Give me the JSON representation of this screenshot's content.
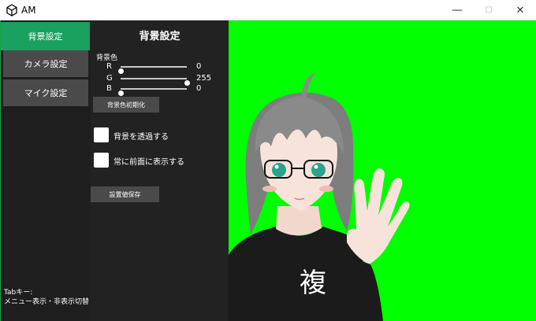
{
  "window": {
    "title": "AM",
    "minimize_glyph": "—",
    "maximize_glyph": "☐",
    "close_glyph": "✕"
  },
  "sidebar": {
    "tabs": [
      {
        "label": "背景設定",
        "active": true
      },
      {
        "label": "カメラ設定",
        "active": false
      },
      {
        "label": "マイク設定",
        "active": false
      }
    ],
    "help_line1": "Tabキー:",
    "help_line2": "メニュー表示・非表示切替"
  },
  "panel": {
    "title": "背景設定",
    "color_label": "背景色",
    "channels": [
      {
        "name": "R",
        "value": "0",
        "level": 0
      },
      {
        "name": "G",
        "value": "255",
        "level": 1
      },
      {
        "name": "B",
        "value": "0",
        "level": 0
      }
    ],
    "reset_button": "背景色初期化",
    "transparent_label": "背景を透過する",
    "transparent_checked": false,
    "topmost_label": "常に前面に表示する",
    "topmost_checked": false,
    "save_button": "設置値保存"
  },
  "preview": {
    "background_color": "#00ff00",
    "shirt_text": "複"
  },
  "colors": {
    "accent": "#1aa05f",
    "sidebar_bg": "#1e1e1e",
    "panel_bg": "#222222",
    "tab_bg": "#4a4a4a"
  }
}
